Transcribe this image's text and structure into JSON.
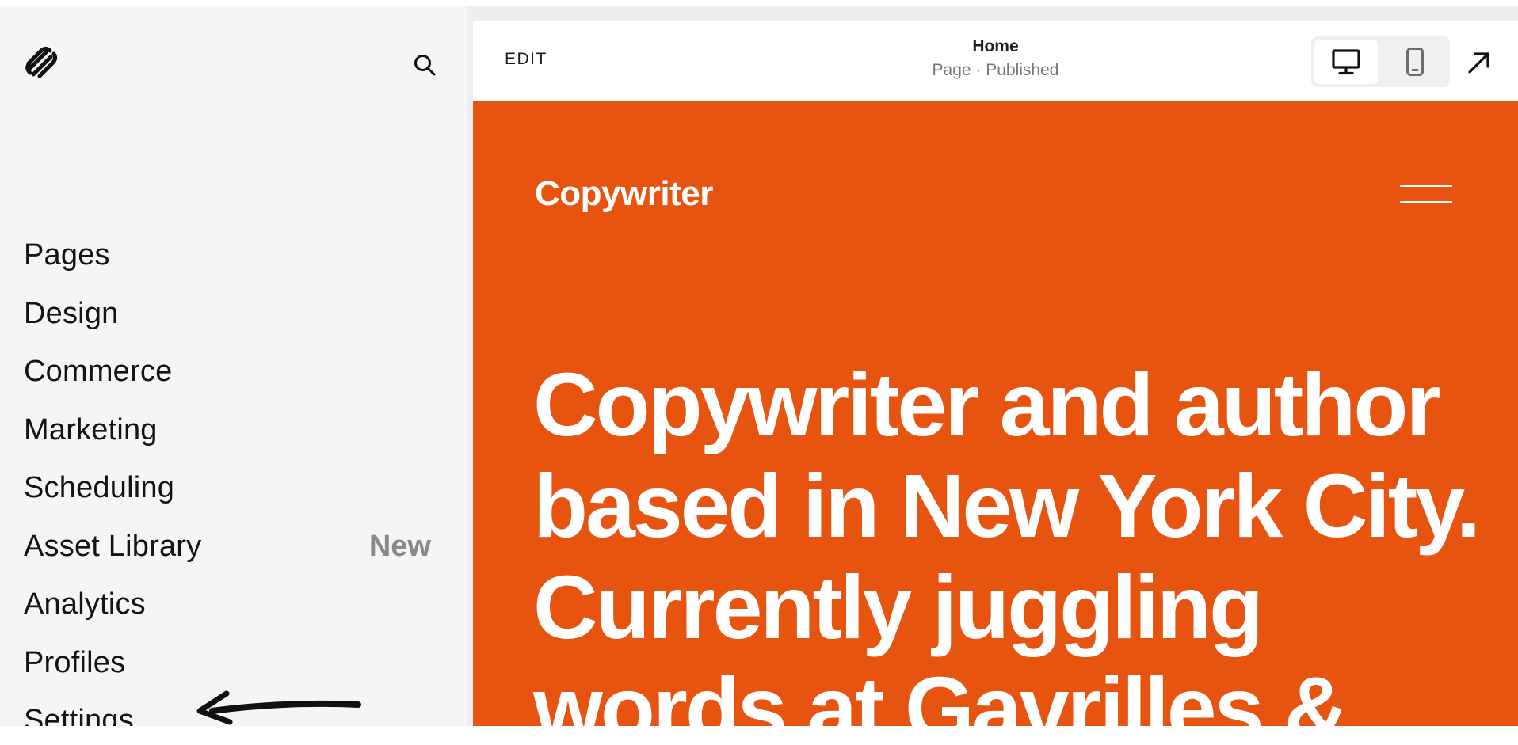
{
  "sidebar": {
    "logo_icon": "squarespace-logo-icon",
    "search_icon": "search-icon",
    "items": [
      {
        "label": "Pages",
        "badge": ""
      },
      {
        "label": "Design",
        "badge": ""
      },
      {
        "label": "Commerce",
        "badge": ""
      },
      {
        "label": "Marketing",
        "badge": ""
      },
      {
        "label": "Scheduling",
        "badge": ""
      },
      {
        "label": "Asset Library",
        "badge": "New"
      },
      {
        "label": "Analytics",
        "badge": ""
      },
      {
        "label": "Profiles",
        "badge": ""
      },
      {
        "label": "Settings",
        "badge": ""
      }
    ]
  },
  "topbar": {
    "edit_label": "EDIT",
    "page_title": "Home",
    "page_status": "Page · Published",
    "view_modes": [
      "desktop-icon",
      "mobile-icon"
    ],
    "selected_view": "desktop",
    "open_icon": "arrow-up-right-icon"
  },
  "preview": {
    "site_title": "Copywriter",
    "menu_icon": "hamburger-menu-icon",
    "hero_text": "Copywriter and author based in New York City. Currently juggling words at Gavrilles &",
    "background_color": "#e75410",
    "text_color": "#ffffff"
  },
  "colors": {
    "sidebar_bg": "#f5f5f5",
    "badge": "#8a8a8a",
    "text": "#141414"
  }
}
